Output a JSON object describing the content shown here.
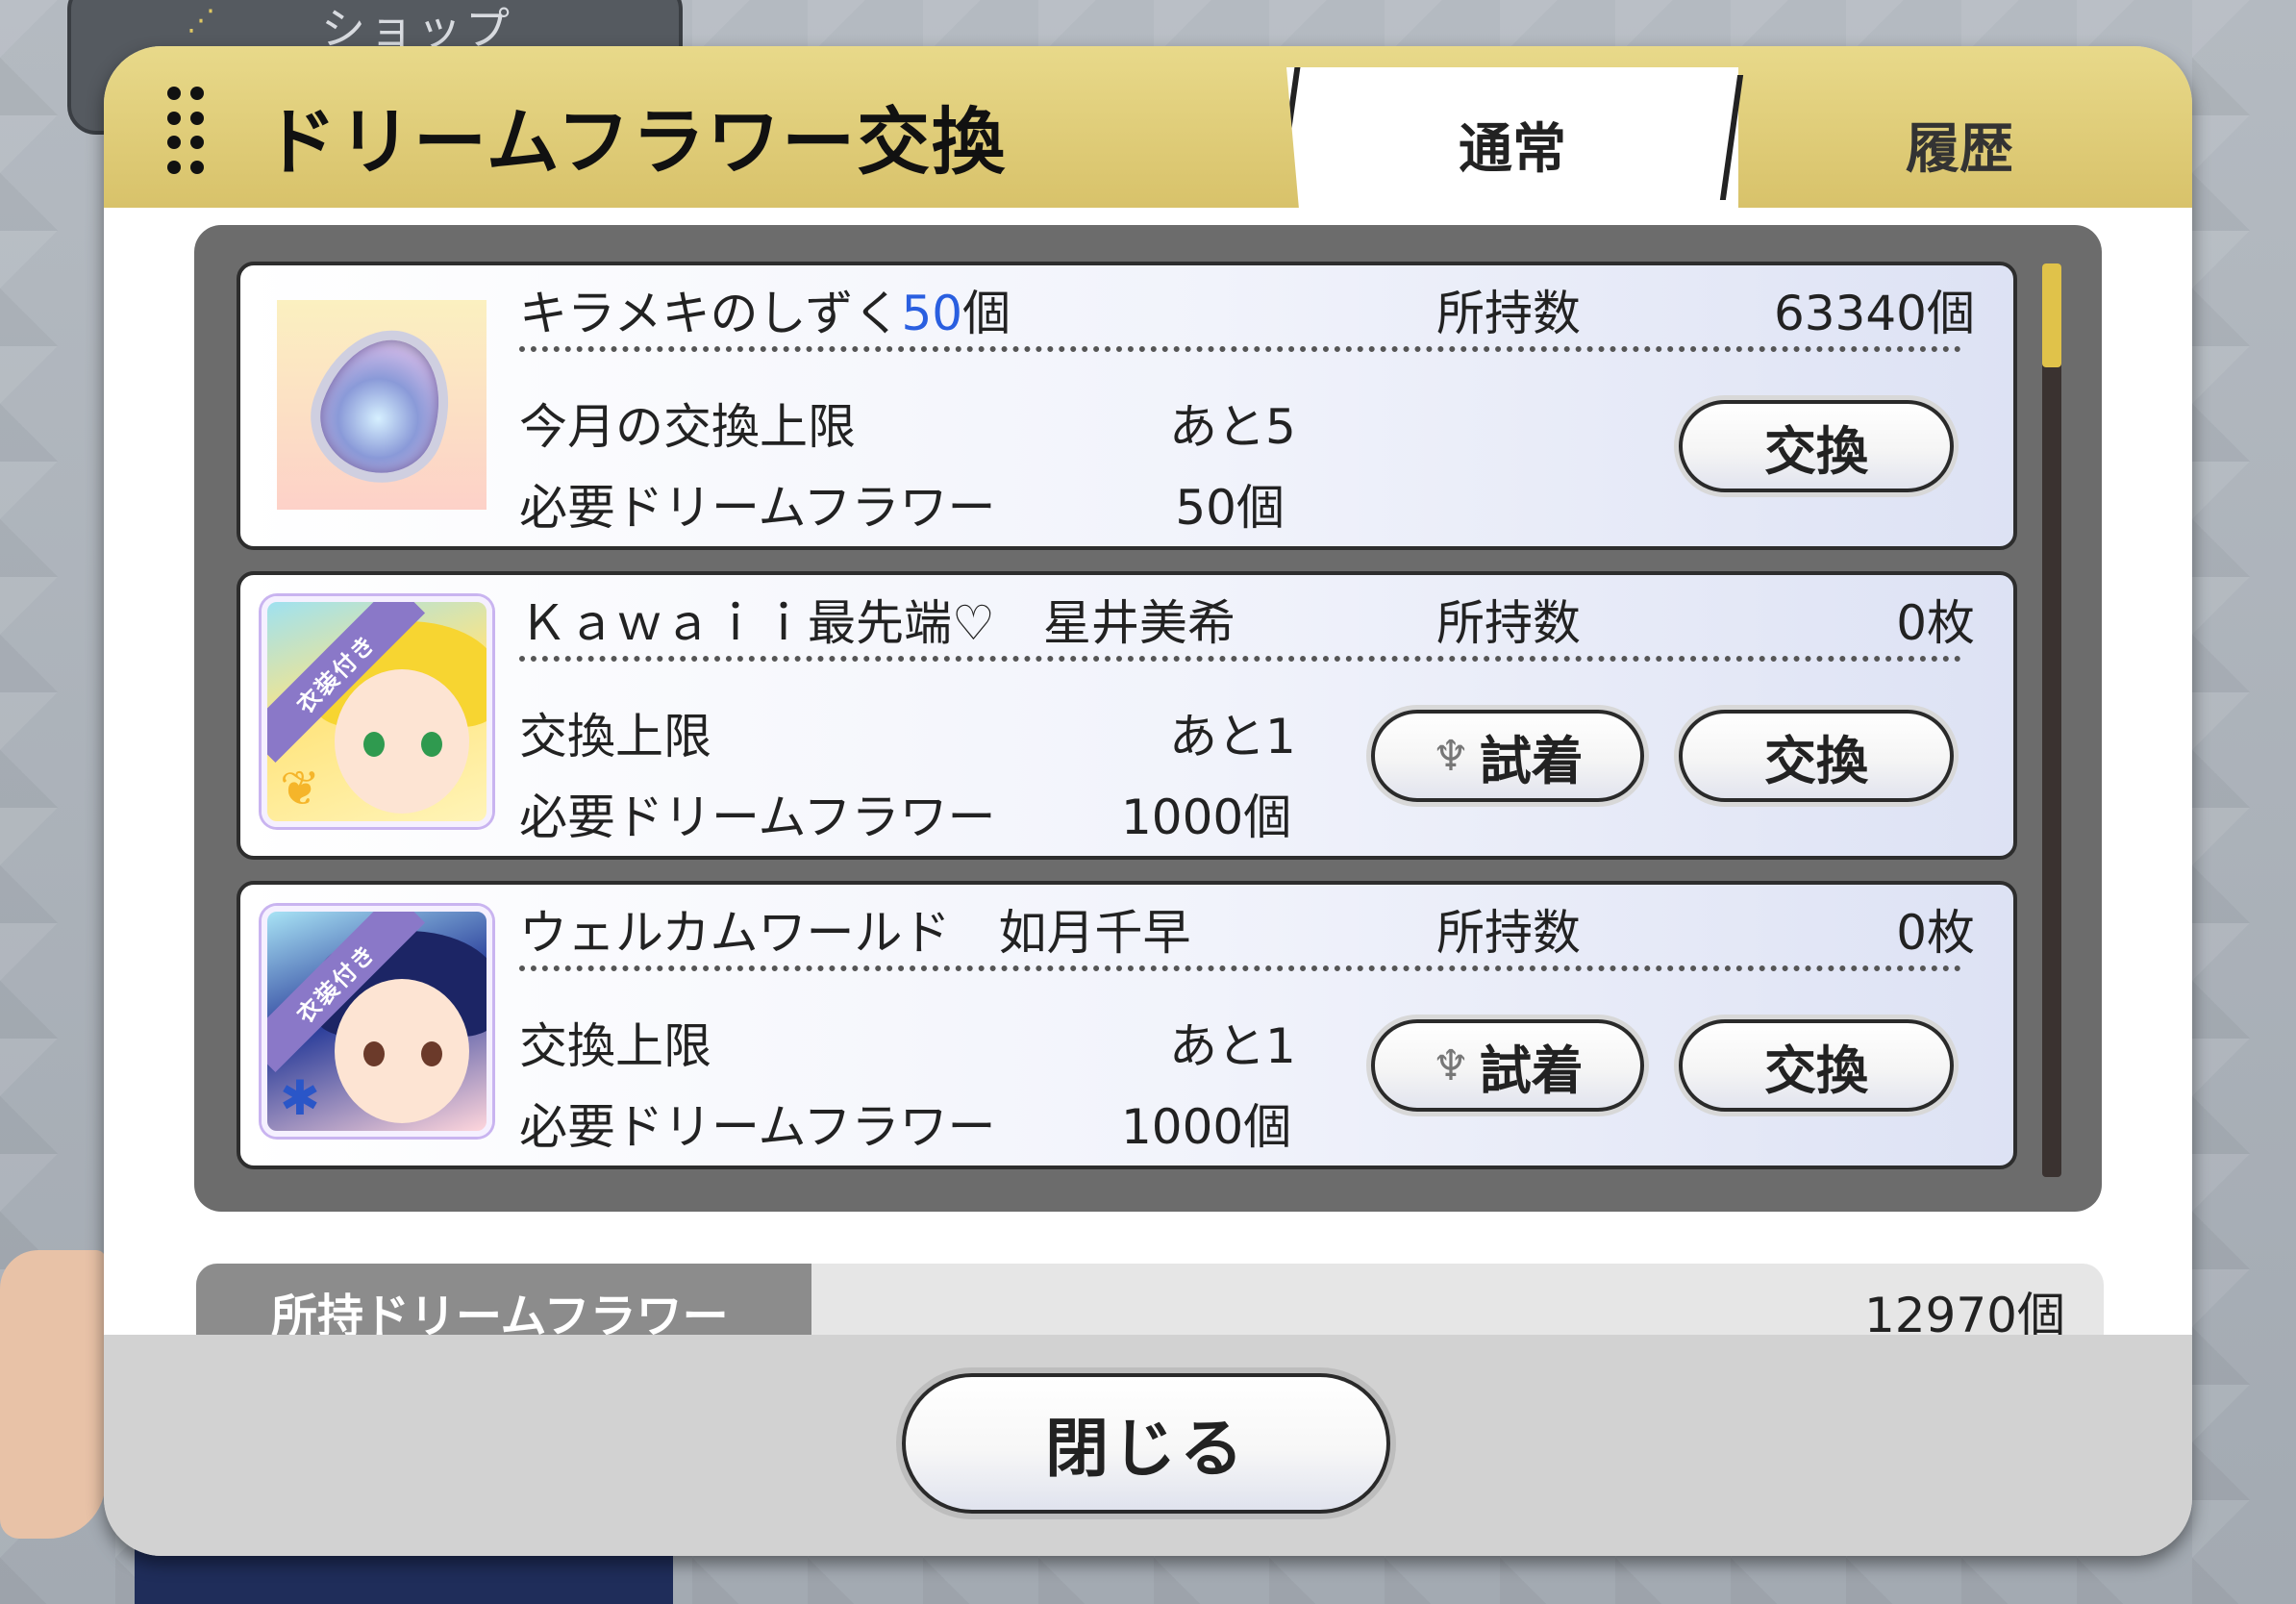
{
  "background": {
    "shop_tab_label": "ショップ"
  },
  "dialog": {
    "title": "ドリームフラワー交換",
    "tabs": [
      {
        "label": "通常",
        "active": true
      },
      {
        "label": "履歴",
        "active": false
      }
    ]
  },
  "items": [
    {
      "name": "キラメキのしずく",
      "quantity_accent": "50",
      "quantity_unit": "個",
      "owned_label": "所持数",
      "owned_value": "63340個",
      "limit_label": "今月の交換上限",
      "limit_value": "あと5",
      "cost_label": "必要ドリームフラワー",
      "cost_value": "50個",
      "exchange_label": "交換",
      "icon": "droplet-gem-icon"
    },
    {
      "name": "Ｋａｗａｉｉ最先端♡　星井美希",
      "owned_label": "所持数",
      "owned_value": "0枚",
      "limit_label": "交換上限",
      "limit_value": "あと1",
      "cost_label": "必要ドリームフラワー",
      "cost_value": "1000個",
      "try_on_label": "試着",
      "exchange_label": "交換",
      "ribbon": "衣装付き",
      "icon": "idol-card-miki"
    },
    {
      "name": "ウェルカムワールド　如月千早",
      "owned_label": "所持数",
      "owned_value": "0枚",
      "limit_label": "交換上限",
      "limit_value": "あと1",
      "cost_label": "必要ドリームフラワー",
      "cost_value": "1000個",
      "try_on_label": "試着",
      "exchange_label": "交換",
      "ribbon": "衣装付き",
      "icon": "idol-card-chihaya"
    }
  ],
  "owned_flowers": {
    "label": "所持ドリームフラワー",
    "value": "12970個"
  },
  "close_label": "閉じる",
  "colors": {
    "header_gold": "#d8c26a",
    "accent_blue": "#2a5fe0",
    "scroll_thumb": "#e0c24a"
  }
}
